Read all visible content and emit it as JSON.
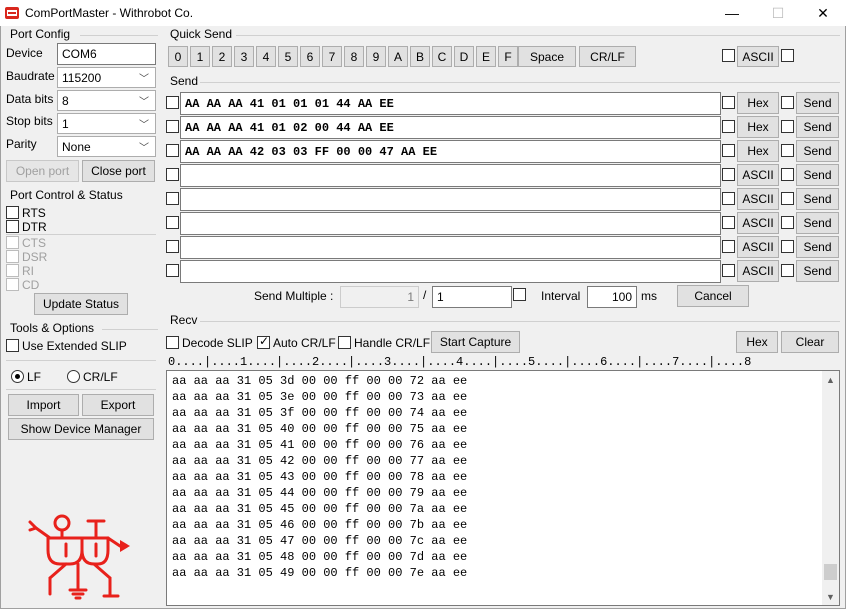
{
  "window": {
    "title": "ComPortMaster - Withrobot Co.",
    "minimize": "—",
    "maximize": "☐",
    "close": "✕"
  },
  "port_config": {
    "title": "Port Config",
    "device_label": "Device",
    "device_value": "COM6",
    "baudrate_label": "Baudrate",
    "baudrate_value": "115200",
    "databits_label": "Data bits",
    "databits_value": "8",
    "stopbits_label": "Stop bits",
    "stopbits_value": "1",
    "parity_label": "Parity",
    "parity_value": "None",
    "open_port": "Open port",
    "close_port": "Close port"
  },
  "port_control": {
    "title": "Port Control & Status",
    "rts": "RTS",
    "dtr": "DTR",
    "cts": "CTS",
    "dsr": "DSR",
    "ri": "RI",
    "cd": "CD",
    "update_status": "Update Status"
  },
  "tools": {
    "title": "Tools & Options",
    "use_extended_slip": "Use Extended SLIP",
    "lf": "LF",
    "crlf": "CR/LF",
    "import": "Import",
    "export": "Export",
    "show_device_manager": "Show Device Manager"
  },
  "quick_send": {
    "title": "Quick Send",
    "keys": [
      "0",
      "1",
      "2",
      "3",
      "4",
      "5",
      "6",
      "7",
      "8",
      "9",
      "A",
      "B",
      "C",
      "D",
      "E",
      "F"
    ],
    "space": "Space",
    "crlf": "CR/LF",
    "ascii": "ASCII"
  },
  "send": {
    "title": "Send",
    "rows": [
      {
        "value": "AA AA AA 41 01 01 01 44 AA EE",
        "mode": "Hex",
        "send": "Send"
      },
      {
        "value": "AA AA AA 41 01 02 00 44 AA EE",
        "mode": "Hex",
        "send": "Send"
      },
      {
        "value": "AA AA AA 42 03 03 FF 00 00 47 AA EE",
        "mode": "Hex",
        "send": "Send"
      },
      {
        "value": "",
        "mode": "ASCII",
        "send": "Send"
      },
      {
        "value": "",
        "mode": "ASCII",
        "send": "Send"
      },
      {
        "value": "",
        "mode": "ASCII",
        "send": "Send"
      },
      {
        "value": "",
        "mode": "ASCII",
        "send": "Send"
      },
      {
        "value": "",
        "mode": "ASCII",
        "send": "Send"
      }
    ],
    "send_multiple_label": "Send Multiple :",
    "send_multiple_current": "1",
    "separator": "/",
    "send_multiple_total": "1",
    "interval_label": "Interval",
    "interval_value": "100",
    "interval_unit": "ms",
    "cancel": "Cancel"
  },
  "recv": {
    "title": "Recv",
    "decode_slip": "Decode SLIP",
    "auto_crlf": "Auto CR/LF",
    "handle_crlf": "Handle CR/LF",
    "start_capture": "Start Capture",
    "hex": "Hex",
    "clear": "Clear",
    "ruler": "0....|....1....|....2....|....3....|....4....|....5....|....6....|....7....|....8",
    "lines": [
      "aa aa aa 31 05 3d 00 00 ff 00 00 72 aa ee",
      "aa aa aa 31 05 3e 00 00 ff 00 00 73 aa ee",
      "aa aa aa 31 05 3f 00 00 ff 00 00 74 aa ee",
      "aa aa aa 31 05 40 00 00 ff 00 00 75 aa ee",
      "aa aa aa 31 05 41 00 00 ff 00 00 76 aa ee",
      "aa aa aa 31 05 42 00 00 ff 00 00 77 aa ee",
      "aa aa aa 31 05 43 00 00 ff 00 00 78 aa ee",
      "aa aa aa 31 05 44 00 00 ff 00 00 79 aa ee",
      "aa aa aa 31 05 45 00 00 ff 00 00 7a aa ee",
      "aa aa aa 31 05 46 00 00 ff 00 00 7b aa ee",
      "aa aa aa 31 05 47 00 00 ff 00 00 7c aa ee",
      "aa aa aa 31 05 48 00 00 ff 00 00 7d aa ee",
      "aa aa aa 31 05 49 00 00 ff 00 00 7e aa ee"
    ]
  },
  "colors": {
    "logo_red": "#e8211b",
    "icon_red": "#d9271d"
  }
}
